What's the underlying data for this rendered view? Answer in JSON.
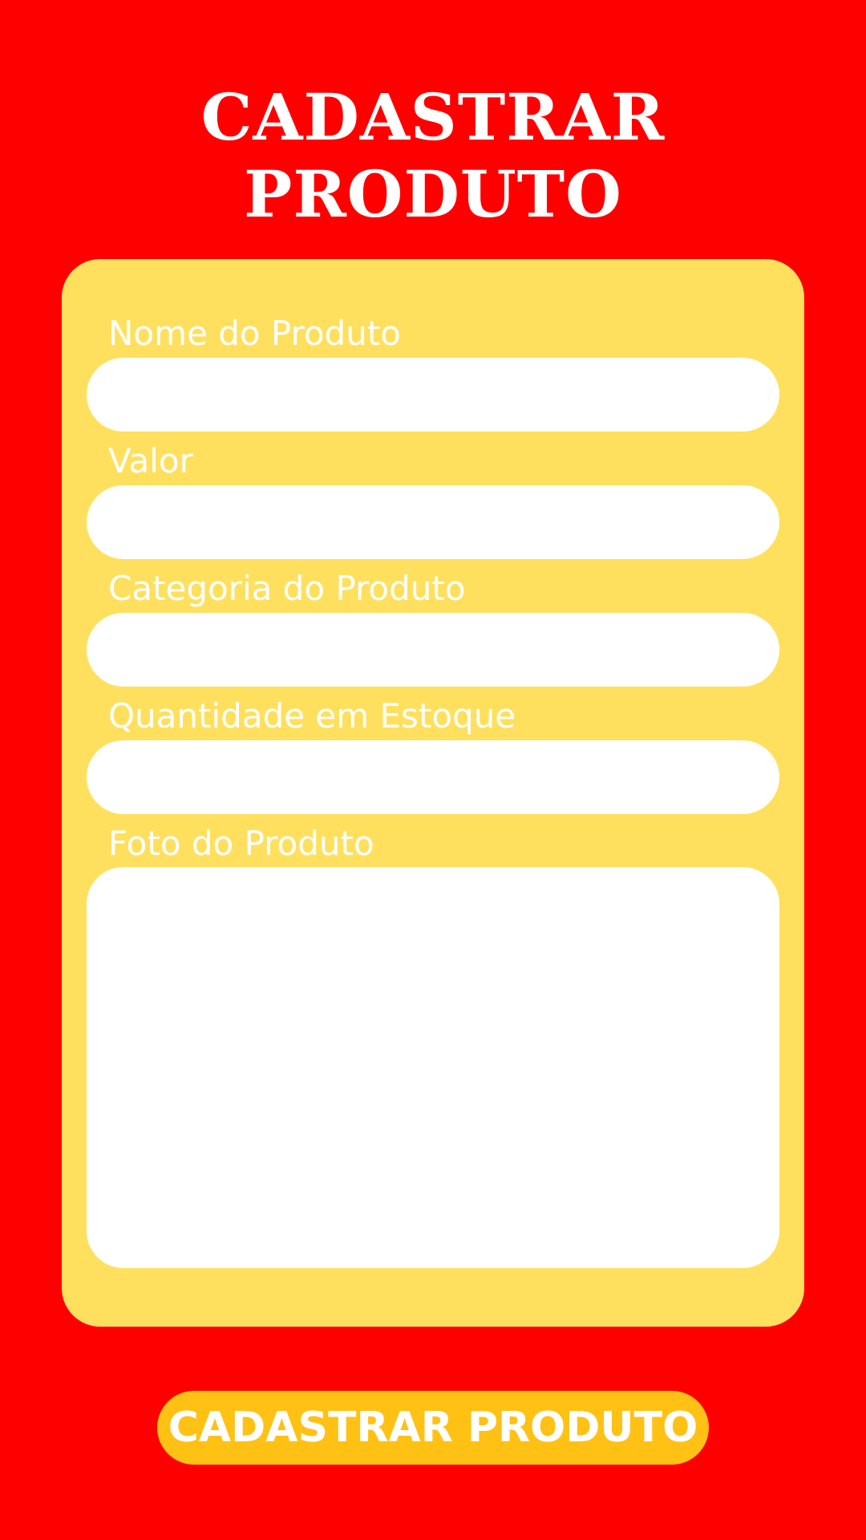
{
  "title": {
    "line1": "CADASTRAR",
    "line2": "PRODUTO"
  },
  "form": {
    "fields": [
      {
        "label": "Nome do Produto",
        "value": ""
      },
      {
        "label": "Valor",
        "value": ""
      },
      {
        "label": "Categoria do Produto",
        "value": ""
      },
      {
        "label": "Quantidade em Estoque",
        "value": ""
      }
    ],
    "photo": {
      "label": "Foto do Produto"
    }
  },
  "submit": {
    "label": "CADASTRAR PRODUTO"
  },
  "colors": {
    "background": "#ff0000",
    "card": "#ffe05e",
    "field": "#ffffff",
    "button": "#ffc114",
    "text": "#ffffff"
  }
}
